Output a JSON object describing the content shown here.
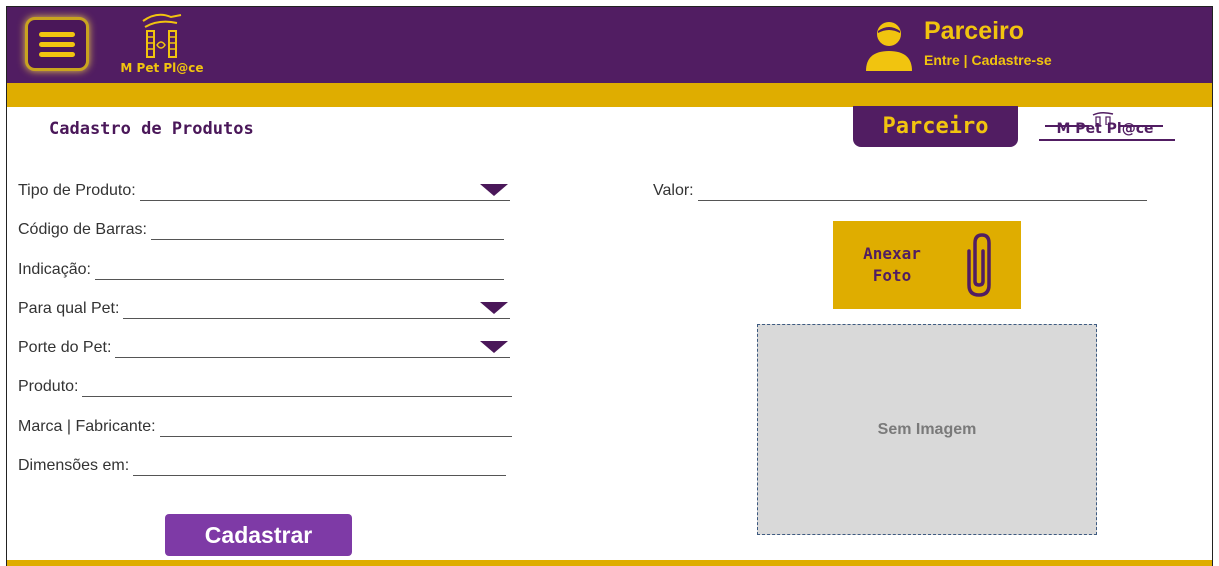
{
  "header": {
    "brand": "M Pet Pl@ce",
    "user_title": "Parceiro",
    "login_link": "Entre",
    "separator": " | ",
    "signup_link": "Cadastre-se"
  },
  "page": {
    "title": "Cadastro de Produtos",
    "role_badge": "Parceiro",
    "brand": "M Pet Pl@ce"
  },
  "form": {
    "tipo_produto": "Tipo de Produto:",
    "codigo_barras": "Código de Barras:",
    "indicacao": "Indicação:",
    "para_qual_pet": "Para qual Pet:",
    "porte_pet": "Porte do Pet:",
    "produto": "Produto:",
    "marca": "Marca | Fabricante:",
    "dimensoes": "Dimensões em:",
    "valor": "Valor:",
    "submit": "Cadastrar",
    "attach_line1": "Anexar",
    "attach_line2": "Foto",
    "image_placeholder": "Sem Imagem"
  },
  "colors": {
    "purple": "#511d62",
    "yellow": "#dfad00",
    "button_purple": "#7e3aa6",
    "image_bg": "#d9d9d9"
  },
  "icons": [
    "menu-icon",
    "pet-place-logo-icon",
    "user-icon",
    "dropdown-caret-icon",
    "paperclip-icon"
  ]
}
